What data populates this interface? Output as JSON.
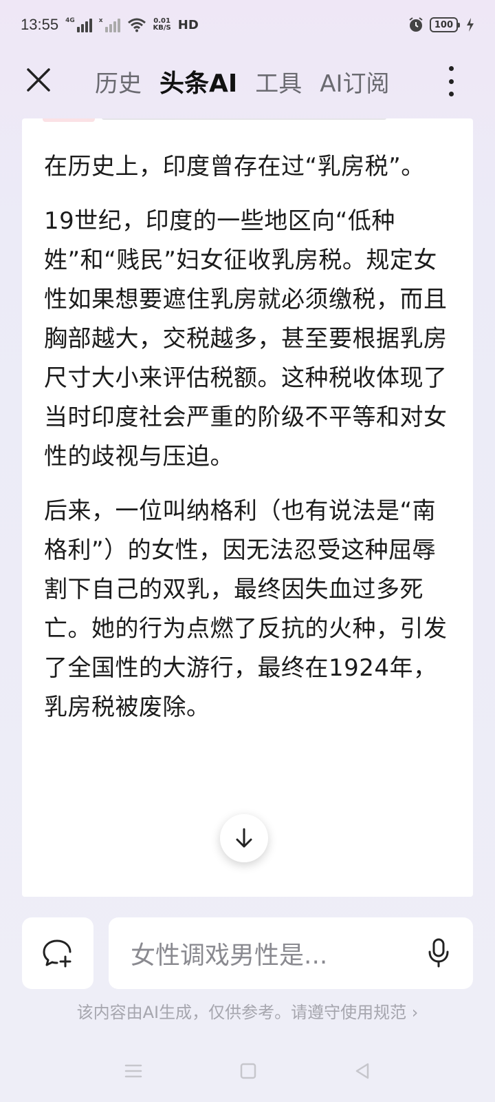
{
  "status_bar": {
    "time": "13:55",
    "signal1_label": "4G",
    "signal2_label": "x",
    "net_speed_value": "0.01",
    "net_speed_unit": "KB/S",
    "hd_label": "HD",
    "battery": "100"
  },
  "topnav": {
    "tabs": [
      {
        "label": "历史"
      },
      {
        "label": "头条AI"
      },
      {
        "label": "工具"
      },
      {
        "label": "AI订阅"
      }
    ],
    "active_tab": "头条AI"
  },
  "article": {
    "paragraphs": [
      "在历史上，印度曾存在过“乳房税”。",
      "19世纪，印度的一些地区向“低种姓”和“贱民”妇女征收乳房税。规定女性如果想要遮住乳房就必须缴税，而且胸部越大，交税越多，甚至要根据乳房尺寸大小来评估税额。这种税收体现了当时印度社会严重的阶级不平等和对女性的歧视与压迫。",
      "后来，一位叫纳格利（也有说法是“南格利”）的女性，因无法忍受这种屈辱割下自己的双乳，最终因失血过多死亡。她的行为点燃了反抗的火种，引发了全国性的大游行，最终在1924年，乳房税被废除。"
    ]
  },
  "input": {
    "value": "女性调戏男性是..."
  },
  "disclaimer": "该内容由AI生成，仅供参考。请遵守使用规范 ›",
  "colors": {
    "background": "#eeeef7",
    "card": "#ffffff",
    "text": "#1b1b1b",
    "muted": "#a6a6ae"
  }
}
